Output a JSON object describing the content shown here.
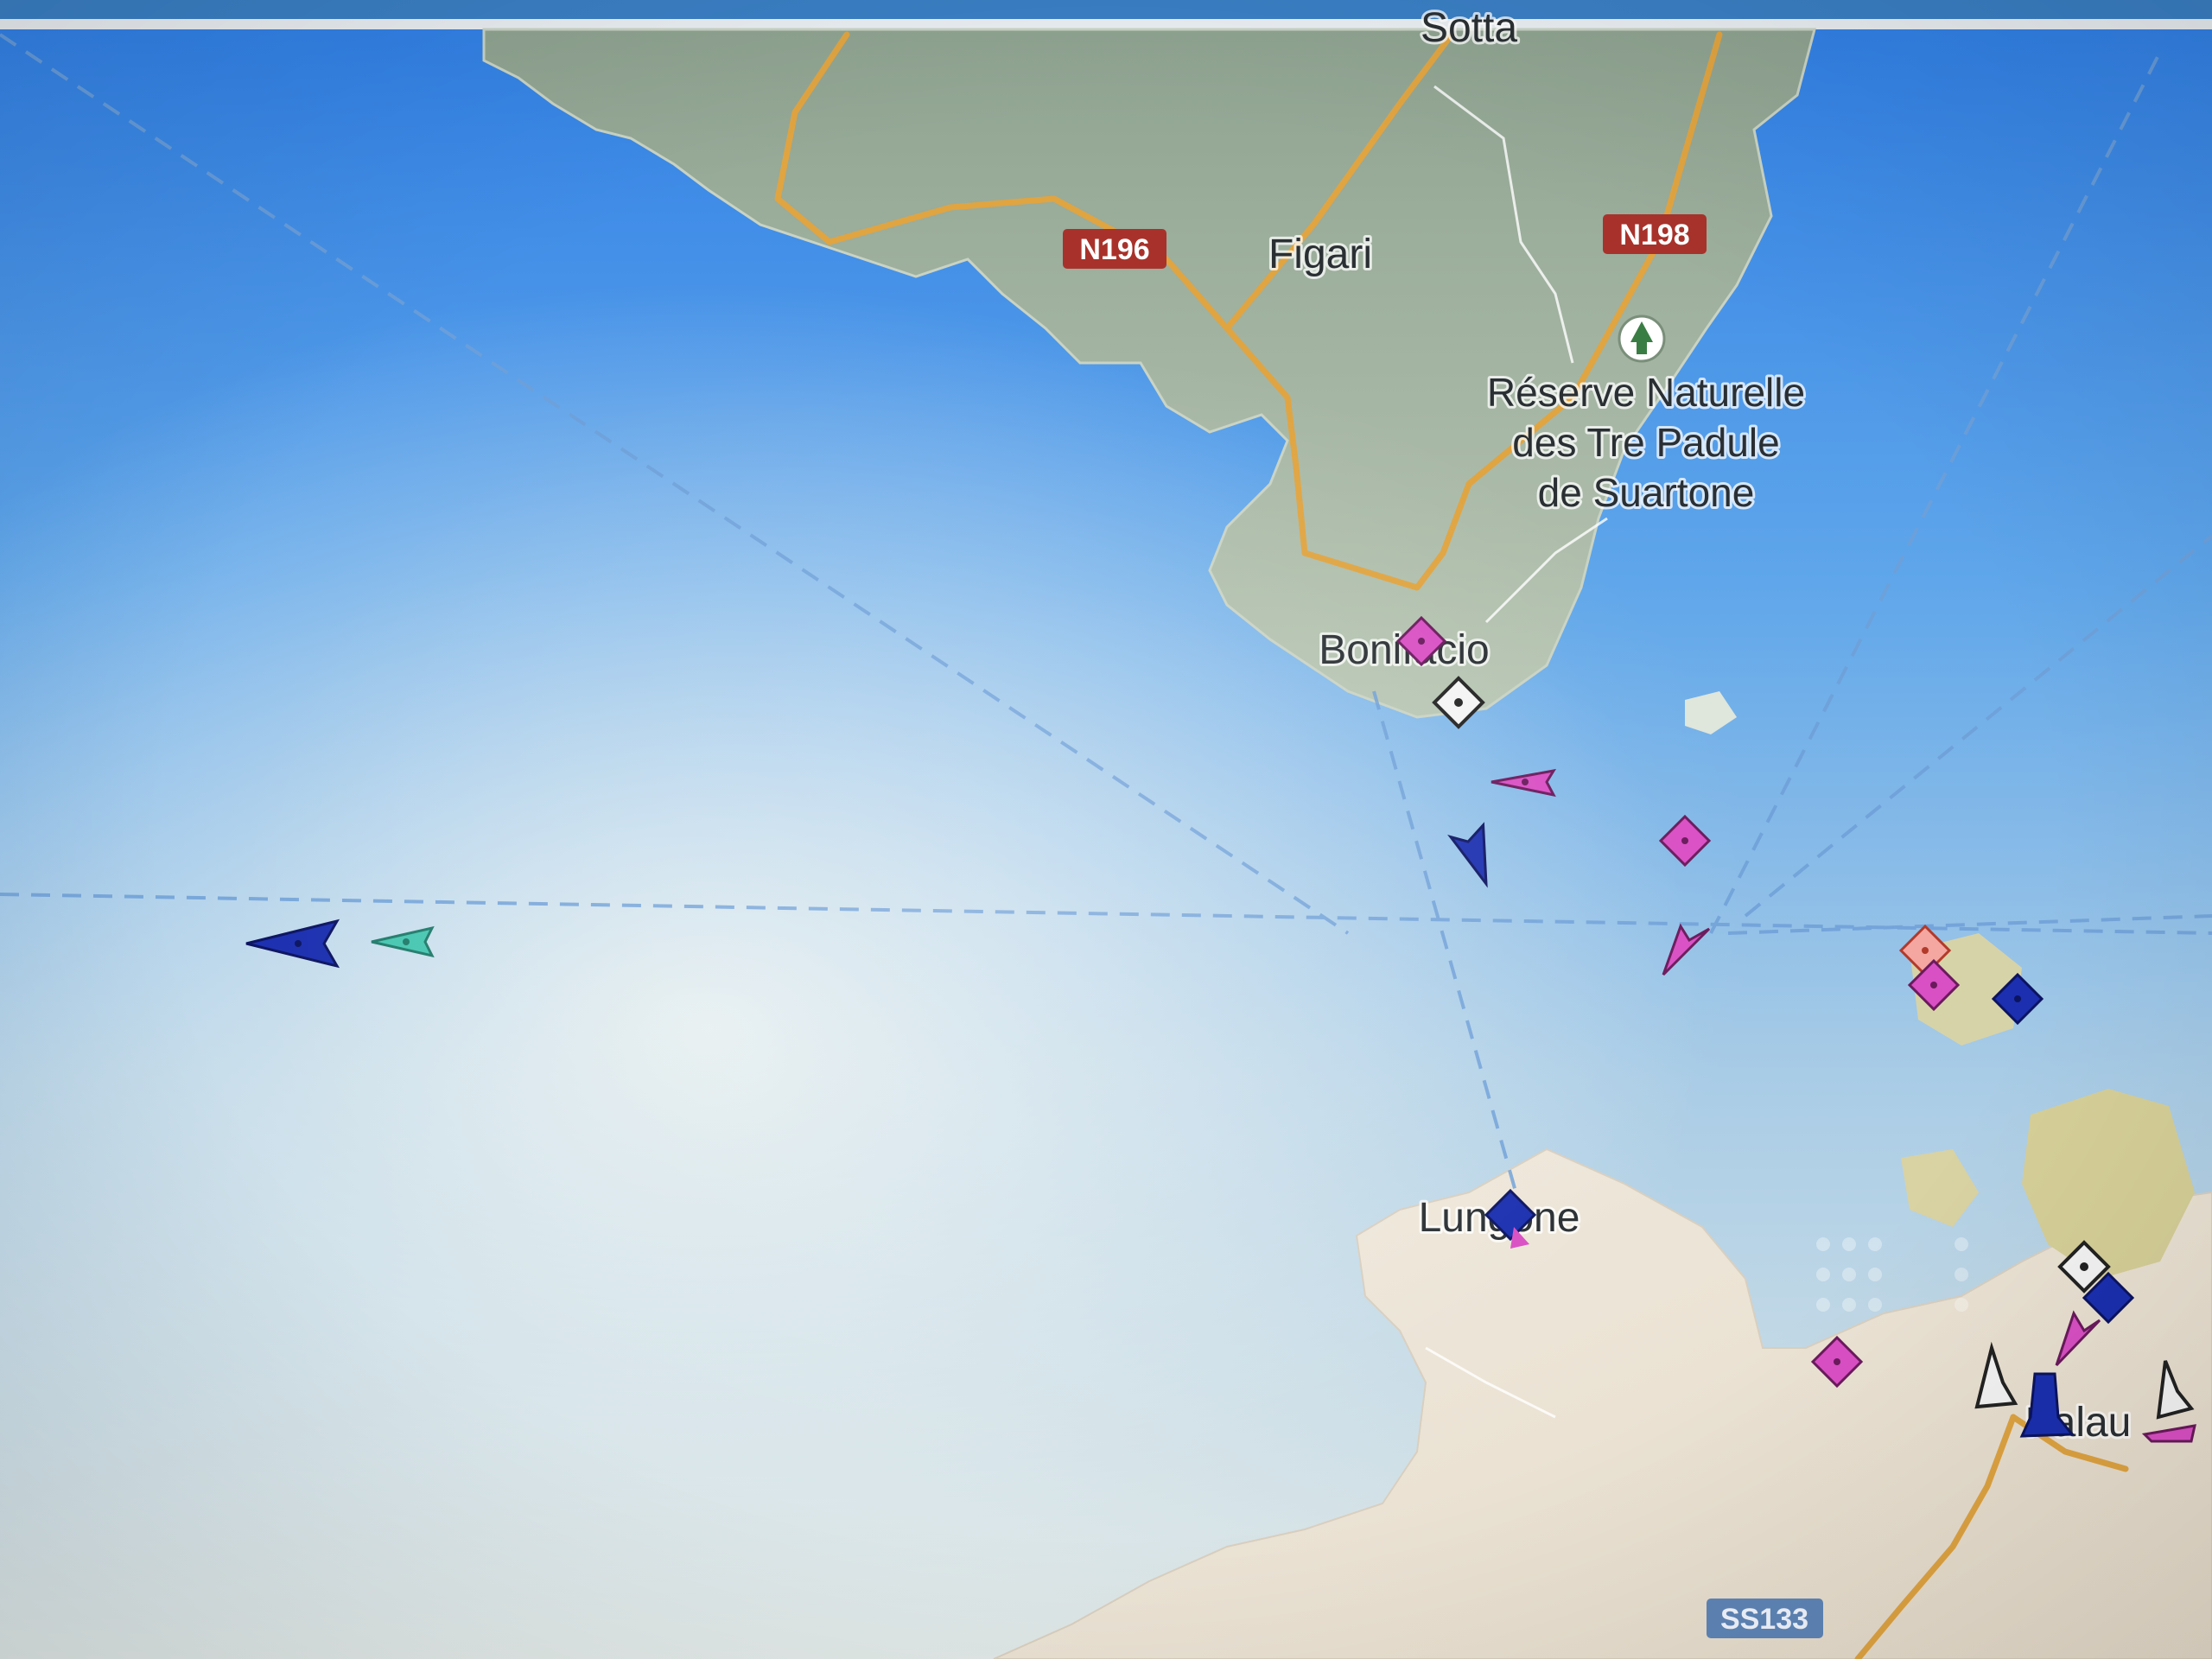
{
  "map": {
    "places": {
      "sotta": "Sotta",
      "figari": "Figari",
      "reserve_line1": "Réserve Naturelle",
      "reserve_line2": "des Tre Padule",
      "reserve_line3": "de Suartone",
      "bonifacio": "Bonifacio",
      "lungone": "Lungone",
      "palau": "Palau"
    },
    "roads": {
      "n196": "N196",
      "n198": "N198",
      "ss133": "SS133"
    },
    "colors": {
      "sea": "#5b9be0",
      "land": "#a9b8a2",
      "land_south": "#e6e0d4",
      "road": "#e0a441",
      "shield_red": "#a8322b",
      "shield_blue": "#5f86b8",
      "vessel_blue": "#1b2fb0",
      "vessel_pink": "#d94fc4",
      "vessel_teal": "#45c6b0",
      "vessel_white": "#f4f4f4"
    },
    "markers": [
      {
        "name": "vessel-cargo-westbound",
        "kind": "arrow",
        "color": "vessel_blue"
      },
      {
        "name": "vessel-teal-westbound",
        "kind": "arrow",
        "color": "vessel_teal"
      },
      {
        "name": "vessel-pink-bonifacio",
        "kind": "diamond",
        "color": "vessel_pink"
      },
      {
        "name": "vessel-anchored-bonifacio",
        "kind": "diamond",
        "color": "vessel_white"
      },
      {
        "name": "vessel-pink-underway-1",
        "kind": "arrow",
        "color": "vessel_pink"
      },
      {
        "name": "vessel-blue-underway",
        "kind": "arrow",
        "color": "vessel_blue"
      },
      {
        "name": "vessel-pink-moored-1",
        "kind": "diamond",
        "color": "vessel_pink"
      },
      {
        "name": "vessel-pink-underway-2",
        "kind": "arrow",
        "color": "vessel_pink"
      },
      {
        "name": "vessel-orange-moored",
        "kind": "diamond",
        "color": "vessel_pink"
      },
      {
        "name": "vessel-pink-moored-2",
        "kind": "diamond",
        "color": "vessel_pink"
      },
      {
        "name": "vessel-blue-moored",
        "kind": "diamond",
        "color": "vessel_blue"
      },
      {
        "name": "vessel-lungone",
        "kind": "diamond",
        "color": "vessel_blue"
      },
      {
        "name": "vessel-pink-palau",
        "kind": "diamond",
        "color": "vessel_pink"
      },
      {
        "name": "vessel-anchored-palau",
        "kind": "diamond",
        "color": "vessel_white"
      },
      {
        "name": "vessel-blue-palau",
        "kind": "diamond",
        "color": "vessel_blue"
      },
      {
        "name": "vessel-pink-palau-ferry",
        "kind": "arrow",
        "color": "vessel_pink"
      },
      {
        "name": "vessel-sail-palau-1",
        "kind": "arrow",
        "color": "vessel_white"
      },
      {
        "name": "vessel-blue-palau-arrow",
        "kind": "arrow",
        "color": "vessel_blue"
      },
      {
        "name": "vessel-sail-palau-2",
        "kind": "arrow",
        "color": "vessel_white"
      },
      {
        "name": "vessel-pink-palau-east",
        "kind": "arrow",
        "color": "vessel_pink"
      }
    ]
  }
}
